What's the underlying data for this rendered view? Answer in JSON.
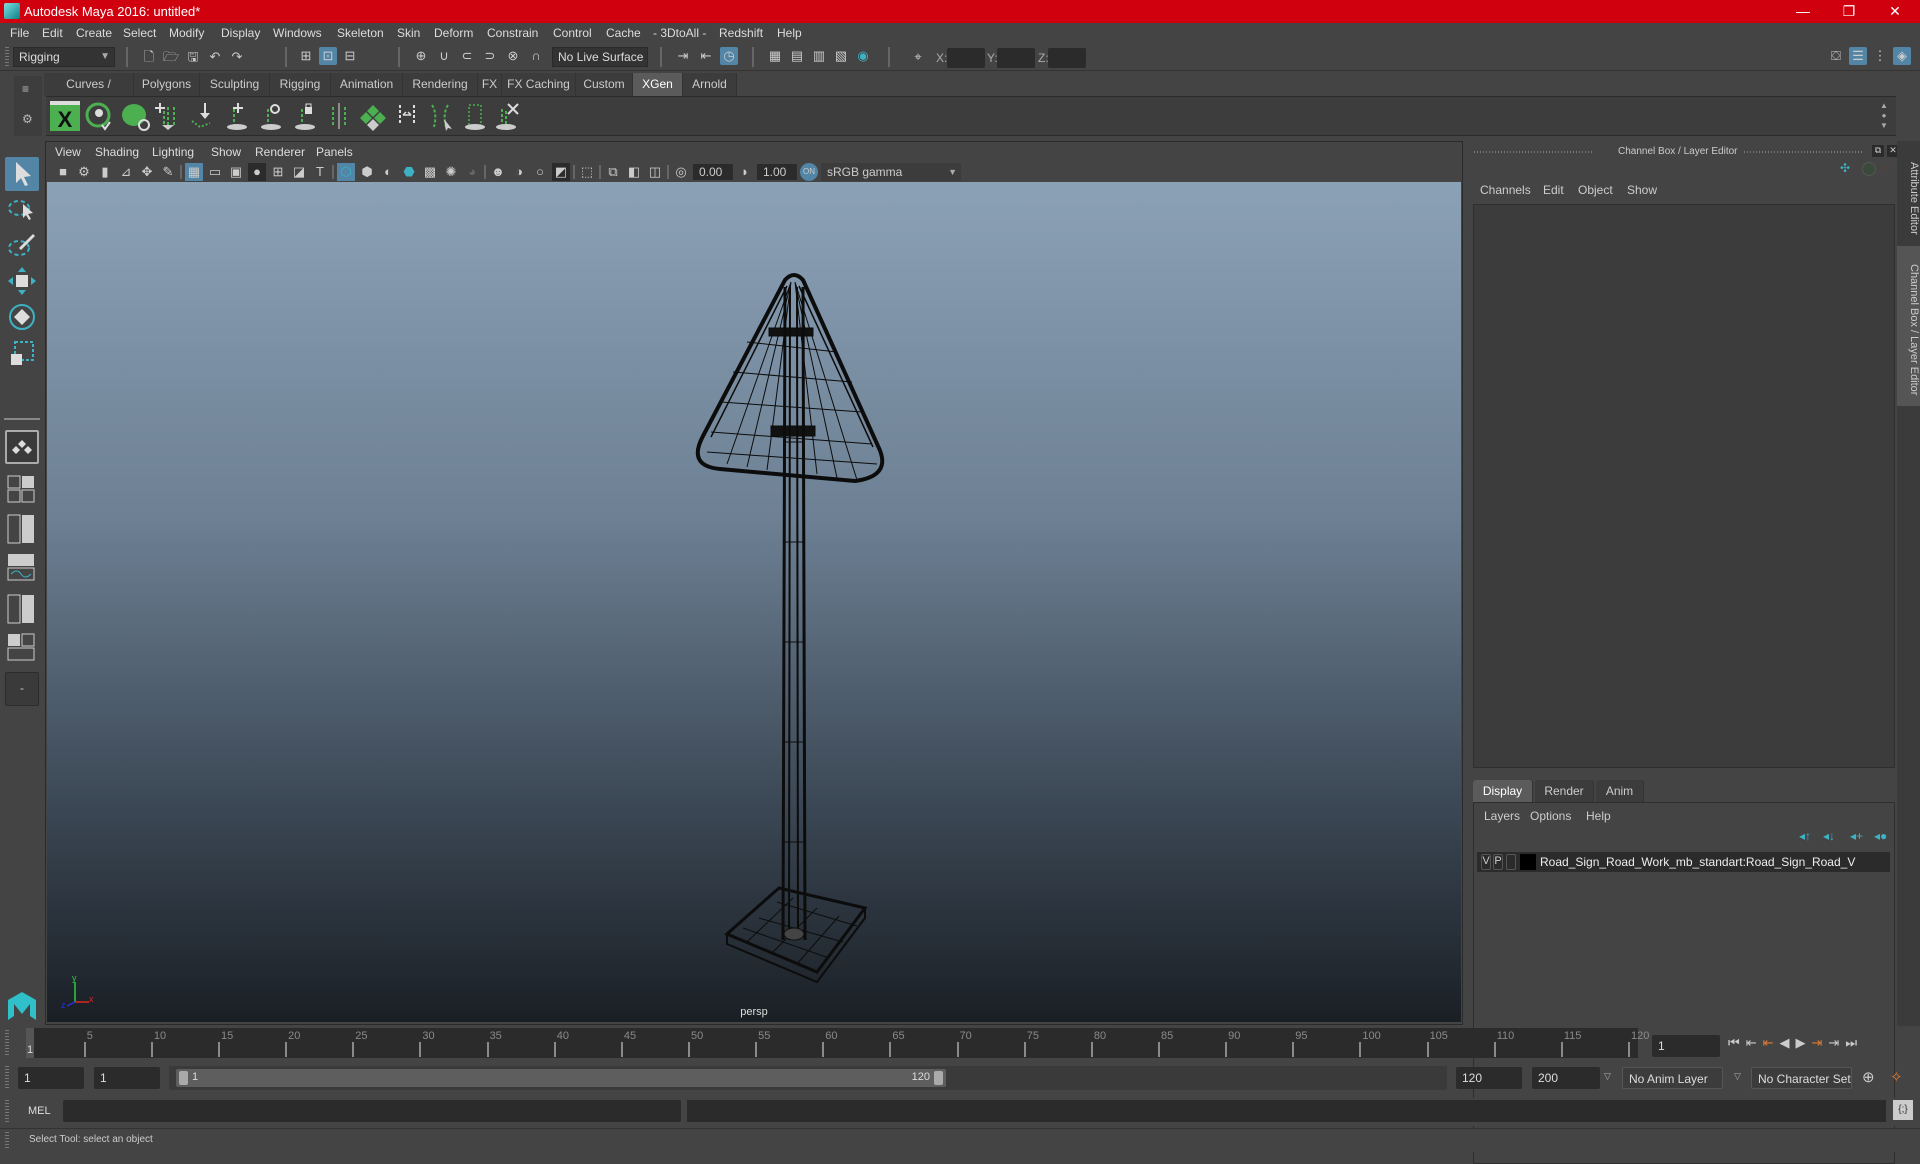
{
  "window": {
    "title": "Autodesk Maya 2016: untitled*",
    "controls": {
      "minimize": "—",
      "restore": "❐",
      "close": "✕"
    }
  },
  "menubar": {
    "items": [
      "File",
      "Edit",
      "Create",
      "Select",
      "Modify",
      "Display",
      "Windows",
      "Skeleton",
      "Skin",
      "Deform",
      "Constrain",
      "Control",
      "Cache",
      "- 3DtoAll -",
      "Redshift",
      "Help"
    ]
  },
  "statusline": {
    "menuset": "Rigging",
    "live_surface": "No Live Surface",
    "xyz_labels": [
      "X:",
      "Y:",
      "Z:"
    ],
    "xyz_values": [
      "",
      "",
      ""
    ]
  },
  "shelf": {
    "tabs": [
      "Curves / Surfaces",
      "Polygons",
      "Sculpting",
      "Rigging",
      "Animation",
      "Rendering",
      "FX",
      "FX Caching",
      "Custom",
      "XGen",
      "Arnold"
    ],
    "active_tab": "XGen",
    "icons": [
      "xgen-editor-icon",
      "xgen-preview-icon",
      "xgen-clear-preview-icon",
      "add-guide-icon",
      "move-guide-icon",
      "append-guide-icon",
      "toggle-guide-visibility-icon",
      "lock-guide-icon",
      "guide-normals-icon",
      "description-icon",
      "fill-guides-icon",
      "select-guides-icon",
      "guide-bounds-icon",
      "delete-guide-icon"
    ]
  },
  "viewport": {
    "menu": [
      "View",
      "Shading",
      "Lighting",
      "Show",
      "Renderer",
      "Panels"
    ],
    "exposure": "0.00",
    "gamma": "1.00",
    "color_space": "sRGB gamma",
    "camera_label": "persp",
    "axis_labels": {
      "x": "x",
      "y": "y",
      "z": "z"
    }
  },
  "channel_box": {
    "title": "Channel Box / Layer Editor",
    "menu": [
      "Channels",
      "Edit",
      "Object",
      "Show"
    ]
  },
  "layer_editor": {
    "tabs": [
      "Display",
      "Render",
      "Anim"
    ],
    "active_tab": "Display",
    "menu": [
      "Layers",
      "Options",
      "Help"
    ],
    "layers": [
      {
        "visible": "V",
        "playback": "P",
        "name": "Road_Sign_Road_Work_mb_standart:Road_Sign_Road_V",
        "color": "#000000"
      }
    ]
  },
  "side_tabs": [
    "Attribute Editor",
    "Channel Box / Layer Editor"
  ],
  "timeline": {
    "ticks": [
      5,
      10,
      15,
      20,
      25,
      30,
      35,
      40,
      45,
      50,
      55,
      60,
      65,
      70,
      75,
      80,
      85,
      90,
      95,
      100,
      105,
      110,
      115,
      120
    ],
    "start": 1,
    "end": 120,
    "current_frame_marker": "1",
    "current_frame": "1"
  },
  "range": {
    "start": "1",
    "playback_start": "1",
    "slider_min_label": "1",
    "slider_max_label": "120",
    "playback_end": "120",
    "end": "200",
    "anim_layer": "No Anim Layer",
    "character_set": "No Character Set"
  },
  "command_line": {
    "label": "MEL",
    "value": ""
  },
  "help_line": "Select Tool: select an object",
  "colors": {
    "titlebar": "#d1000f",
    "accent": "#5285a6",
    "panel": "#444444",
    "field": "#2b2b2b"
  }
}
